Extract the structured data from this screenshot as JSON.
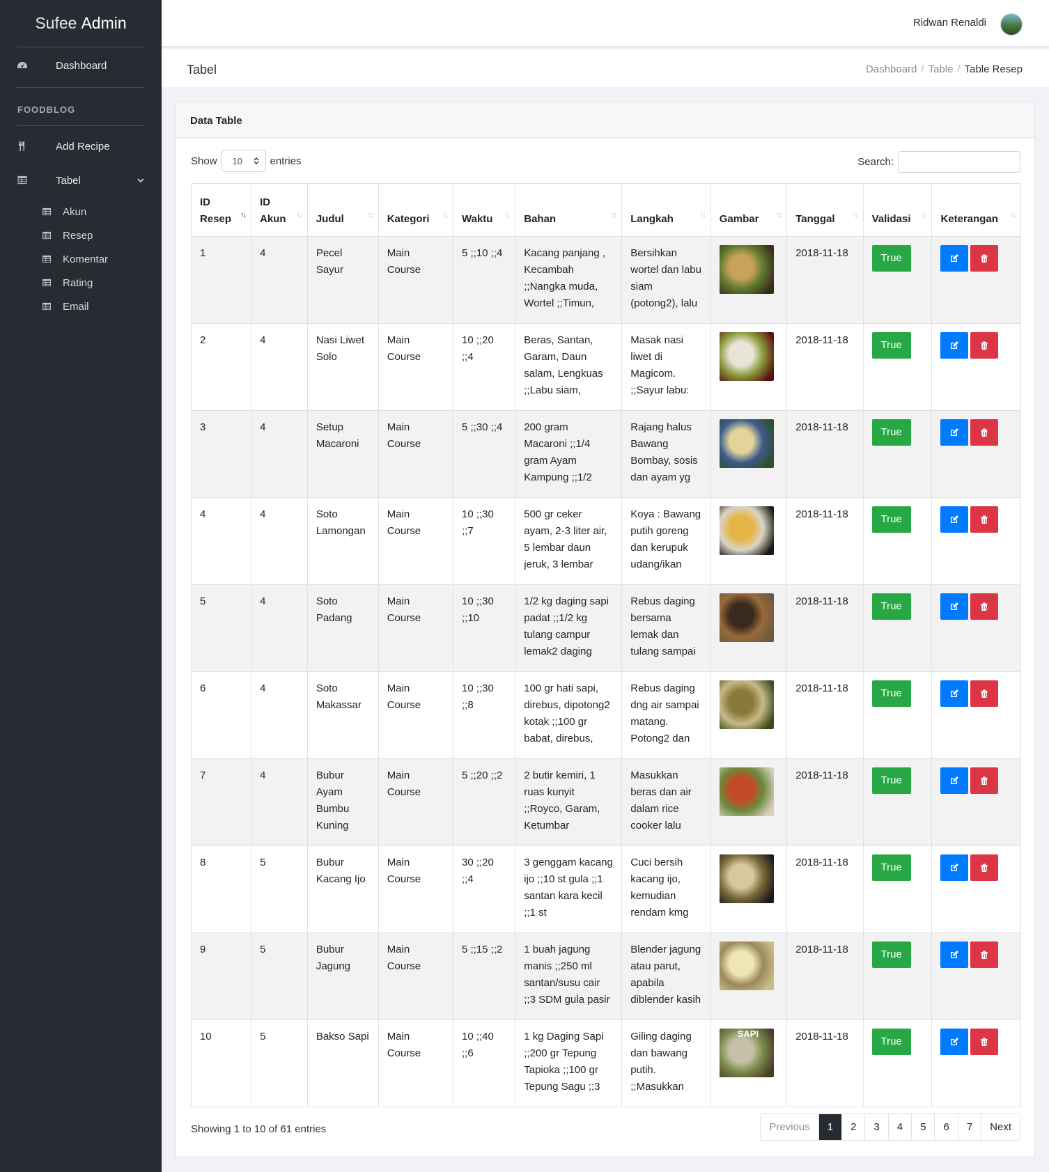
{
  "brand": {
    "part1": "Sufee",
    "part2": "Admin"
  },
  "sidebar": {
    "dashboard": "Dashboard",
    "section": "FOODBLOG",
    "add_recipe": "Add Recipe",
    "tabel": "Tabel",
    "sub": [
      "Akun",
      "Resep",
      "Komentar",
      "Rating",
      "Email"
    ]
  },
  "header": {
    "user_name": "Ridwan Renaldi"
  },
  "breadcrumb": {
    "title": "Tabel",
    "items": [
      "Dashboard",
      "Table",
      "Table Resep"
    ]
  },
  "card": {
    "title": "Data Table"
  },
  "controls": {
    "show_label": "Show",
    "show_value": "10",
    "entries_label": "entries",
    "search_label": "Search:",
    "search_value": ""
  },
  "columns": [
    {
      "line1": "ID",
      "line2": "Resep"
    },
    {
      "line1": "ID",
      "line2": "Akun"
    },
    {
      "line1": "",
      "line2": "Judul"
    },
    {
      "line1": "",
      "line2": "Kategori"
    },
    {
      "line1": "",
      "line2": "Waktu"
    },
    {
      "line1": "",
      "line2": "Bahan"
    },
    {
      "line1": "",
      "line2": "Langkah"
    },
    {
      "line1": "",
      "line2": "Gambar"
    },
    {
      "line1": "",
      "line2": "Tanggal"
    },
    {
      "line1": "",
      "line2": "Validasi"
    },
    {
      "line1": "",
      "line2": "Keterangan"
    }
  ],
  "rows": [
    {
      "id": "1",
      "akun": "4",
      "judul": "Pecel Sayur",
      "kategori": "Main Course",
      "waktu": "5 ;;10 ;;4",
      "bahan": "Kacang panjang , Kecambah ;;Nangka muda, Wortel ;;Timun,",
      "langkah": "Bersihkan wortel dan labu siam (potong2), lalu",
      "tanggal": "2018-11-18",
      "validasi": "True",
      "thumb": [
        "#3a2a1c",
        "#c9a25a",
        "#5e7a2e"
      ]
    },
    {
      "id": "2",
      "akun": "4",
      "judul": "Nasi Liwet Solo",
      "kategori": "Main Course",
      "waktu": "10 ;;20 ;;4",
      "bahan": "Beras, Santan, Garam, Daun salam, Lengkuas ;;Labu siam,",
      "langkah": "Masak nasi liwet di Magicom. ;;Sayur labu:",
      "tanggal": "2018-11-18",
      "validasi": "True",
      "thumb": [
        "#5a0f12",
        "#e8e4da",
        "#8a9a3a"
      ]
    },
    {
      "id": "3",
      "akun": "4",
      "judul": "Setup Macaroni",
      "kategori": "Main Course",
      "waktu": "5 ;;30 ;;4",
      "bahan": "200 gram Macaroni ;;1/4 gram Ayam Kampung ;;1/2",
      "langkah": "Rajang halus Bawang Bombay, sosis dan ayam yg",
      "tanggal": "2018-11-18",
      "validasi": "True",
      "thumb": [
        "#2f4f2a",
        "#e2d49a",
        "#3c5a8a"
      ]
    },
    {
      "id": "4",
      "akun": "4",
      "judul": "Soto Lamongan",
      "kategori": "Main Course",
      "waktu": "10 ;;30 ;;7",
      "bahan": "500 gr ceker ayam, 2-3 liter air, 5 lembar daun jeruk, 3 lembar",
      "langkah": "Koya : Bawang putih goreng dan kerupuk udang/ikan",
      "tanggal": "2018-11-18",
      "validasi": "True",
      "thumb": [
        "#1c1a16",
        "#e6b547",
        "#d9d4c6"
      ]
    },
    {
      "id": "5",
      "akun": "4",
      "judul": "Soto Padang",
      "kategori": "Main Course",
      "waktu": "10 ;;30 ;;10",
      "bahan": "1/2 kg daging sapi padat ;;1/2 kg tulang campur lemak2 daging",
      "langkah": "Rebus daging bersama lemak dan tulang sampai empuk.",
      "tanggal": "2018-11-18",
      "validasi": "True",
      "thumb": [
        "#6a5a42",
        "#3a2a1e",
        "#9a6a3a"
      ]
    },
    {
      "id": "6",
      "akun": "4",
      "judul": "Soto Makassar",
      "kategori": "Main Course",
      "waktu": "10 ;;30 ;;8",
      "bahan": "100 gr hati sapi, direbus, dipotong2 kotak ;;100 gr babat, direbus,",
      "langkah": "Rebus daging dng air sampai matang. Potong2 dan",
      "tanggal": "2018-11-18",
      "validasi": "True",
      "thumb": [
        "#3a4a1a",
        "#8a7a3a",
        "#c7b98a"
      ]
    },
    {
      "id": "7",
      "akun": "4",
      "judul": "Bubur Ayam Bumbu Kuning",
      "kategori": "Main Course",
      "waktu": "5 ;;20 ;;2",
      "bahan": "2 butir kemiri, 1 ruas kunyit ;;Royco, Garam, Ketumbar",
      "langkah": "Masukkan beras dan air dalam rice cooker lalu",
      "tanggal": "2018-11-18",
      "validasi": "True",
      "thumb": [
        "#d8cfc0",
        "#c24a2a",
        "#6a8a3a"
      ]
    },
    {
      "id": "8",
      "akun": "5",
      "judul": "Bubur Kacang Ijo",
      "kategori": "Main Course",
      "waktu": "30 ;;20 ;;4",
      "bahan": "3 genggam kacang ijo ;;10 st gula ;;1 santan kara kecil ;;1 st",
      "langkah": "Cuci bersih kacang ijo, kemudian rendam kmg",
      "tanggal": "2018-11-18",
      "validasi": "True",
      "thumb": [
        "#1a1a1a",
        "#d8c8a0",
        "#7a6a3a"
      ]
    },
    {
      "id": "9",
      "akun": "5",
      "judul": "Bubur Jagung",
      "kategori": "Main Course",
      "waktu": "5 ;;15 ;;2",
      "bahan": "1 buah jagung manis ;;250 ml santan/susu cair ;;3 SDM gula pasir",
      "langkah": "Blender jagung atau parut, apabila diblender kasih",
      "tanggal": "2018-11-18",
      "validasi": "True",
      "thumb": [
        "#cbbf8a",
        "#efe6b8",
        "#9a8a5a"
      ]
    },
    {
      "id": "10",
      "akun": "5",
      "judul": "Bakso Sapi",
      "kategori": "Main Course",
      "waktu": "10 ;;40 ;;6",
      "bahan": "1 kg Daging Sapi ;;200 gr Tepung Tapioka ;;100 gr Tepung Sagu ;;3",
      "langkah": "Giling daging dan bawang putih. ;;Masukkan",
      "tanggal": "2018-11-18",
      "validasi": "True",
      "thumb": [
        "#4a3a2a",
        "#c7c0a8",
        "#7a8a4a"
      ],
      "thumb_text": "SAPI"
    }
  ],
  "footer": {
    "info": "Showing 1 to 10 of 61 entries"
  },
  "pagination": [
    "Previous",
    "1",
    "2",
    "3",
    "4",
    "5",
    "6",
    "7",
    "Next"
  ],
  "colors": {
    "sidebar": "#272c33",
    "true_btn": "#28a745",
    "edit_btn": "#007bff",
    "delete_btn": "#dc3545",
    "page_active": "#272c33"
  }
}
